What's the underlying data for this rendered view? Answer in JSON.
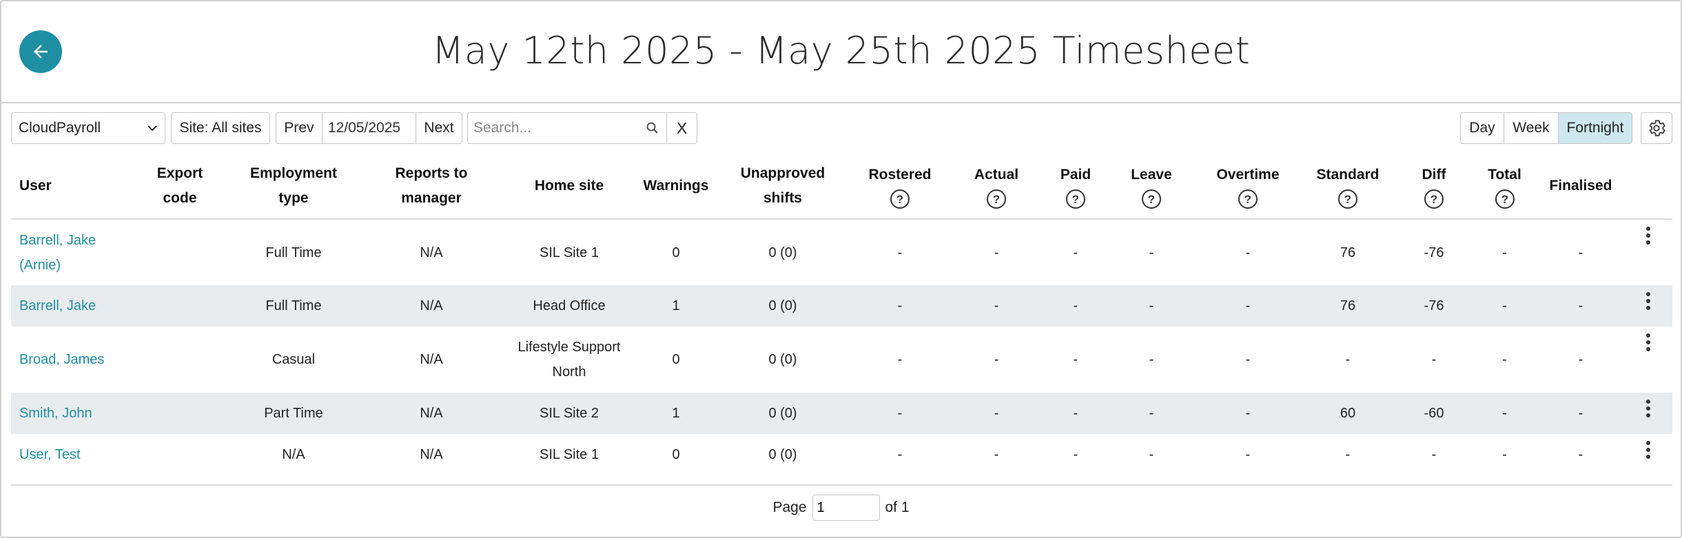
{
  "header": {
    "title": "May 12th 2025 - May 25th 2025 Timesheet",
    "back_icon": "arrow-left-icon",
    "accent_color": "#1f8fa3"
  },
  "toolbar": {
    "export_select_value": "CloudPayroll",
    "site_label": "Site: All sites",
    "prev_label": "Prev",
    "date_value": "12/05/2025",
    "next_label": "Next",
    "search_placeholder": "Search...",
    "clear_label": "X",
    "views": [
      "Day",
      "Week",
      "Fortnight"
    ],
    "active_view": "Fortnight"
  },
  "table": {
    "headers": {
      "user": "User",
      "export_code_1": "Export",
      "export_code_2": "code",
      "employment_type_1": "Employment",
      "employment_type_2": "type",
      "reports_to_1": "Reports to",
      "reports_to_2": "manager",
      "home_site": "Home site",
      "warnings": "Warnings",
      "unapproved_1": "Unapproved",
      "unapproved_2": "shifts",
      "rostered": "Rostered",
      "actual": "Actual",
      "paid": "Paid",
      "leave": "Leave",
      "overtime": "Overtime",
      "standard": "Standard",
      "diff": "Diff",
      "total": "Total",
      "finalised": "Finalised"
    },
    "rows": [
      {
        "user_1": "Barrell, Jake",
        "user_2": "(Arnie)",
        "export_code": "",
        "employment_type": "Full Time",
        "reports_to": "N/A",
        "home_site_1": "SIL Site 1",
        "home_site_2": "",
        "warnings": "0",
        "unapproved": "0 (0)",
        "rostered": "-",
        "actual": "-",
        "paid": "-",
        "leave": "-",
        "overtime": "-",
        "standard": "76",
        "diff": "-76",
        "total": "-",
        "finalised": "-"
      },
      {
        "user_1": "Barrell, Jake",
        "user_2": "",
        "export_code": "",
        "employment_type": "Full Time",
        "reports_to": "N/A",
        "home_site_1": "Head Office",
        "home_site_2": "",
        "warnings": "1",
        "unapproved": "0 (0)",
        "rostered": "-",
        "actual": "-",
        "paid": "-",
        "leave": "-",
        "overtime": "-",
        "standard": "76",
        "diff": "-76",
        "total": "-",
        "finalised": "-"
      },
      {
        "user_1": "Broad, James",
        "user_2": "",
        "export_code": "",
        "employment_type": "Casual",
        "reports_to": "N/A",
        "home_site_1": "Lifestyle Support",
        "home_site_2": "North",
        "warnings": "0",
        "unapproved": "0 (0)",
        "rostered": "-",
        "actual": "-",
        "paid": "-",
        "leave": "-",
        "overtime": "-",
        "standard": "-",
        "diff": "-",
        "total": "-",
        "finalised": "-"
      },
      {
        "user_1": "Smith, John",
        "user_2": "",
        "export_code": "",
        "employment_type": "Part Time",
        "reports_to": "N/A",
        "home_site_1": "SIL Site 2",
        "home_site_2": "",
        "warnings": "1",
        "unapproved": "0 (0)",
        "rostered": "-",
        "actual": "-",
        "paid": "-",
        "leave": "-",
        "overtime": "-",
        "standard": "60",
        "diff": "-60",
        "total": "-",
        "finalised": "-"
      },
      {
        "user_1": "User, Test",
        "user_2": "",
        "export_code": "",
        "employment_type": "N/A",
        "reports_to": "N/A",
        "home_site_1": "SIL Site 1",
        "home_site_2": "",
        "warnings": "0",
        "unapproved": "0 (0)",
        "rostered": "-",
        "actual": "-",
        "paid": "-",
        "leave": "-",
        "overtime": "-",
        "standard": "-",
        "diff": "-",
        "total": "-",
        "finalised": "-"
      }
    ]
  },
  "pager": {
    "page_label": "Page",
    "page_value": "1",
    "of_label": "of 1"
  }
}
